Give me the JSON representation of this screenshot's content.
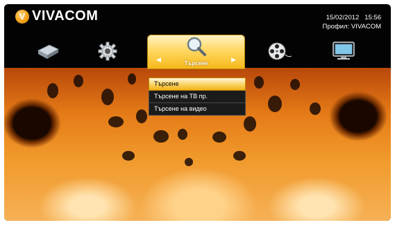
{
  "brand": {
    "mark": "V",
    "name": "VIVACOM"
  },
  "status": {
    "date": "15/02/2012",
    "time": "15:56",
    "profile": "Профил: VIVACOM"
  },
  "nav": {
    "items": [
      {
        "icon": "disk-drive-icon"
      },
      {
        "icon": "gear-icon"
      },
      {
        "icon": "search-icon",
        "label": "Търсене",
        "active": true
      },
      {
        "icon": "film-reel-icon"
      },
      {
        "icon": "tv-monitor-icon"
      }
    ],
    "arrow_left": "◀",
    "arrow_right": "▶"
  },
  "search_menu": {
    "items": [
      "Търсене",
      "Търсене на ТВ пр.",
      "Търсене на видео"
    ],
    "selected_index": 0
  },
  "colors": {
    "accent": "#f6b718",
    "menu_bg": "#1b1b1b"
  }
}
